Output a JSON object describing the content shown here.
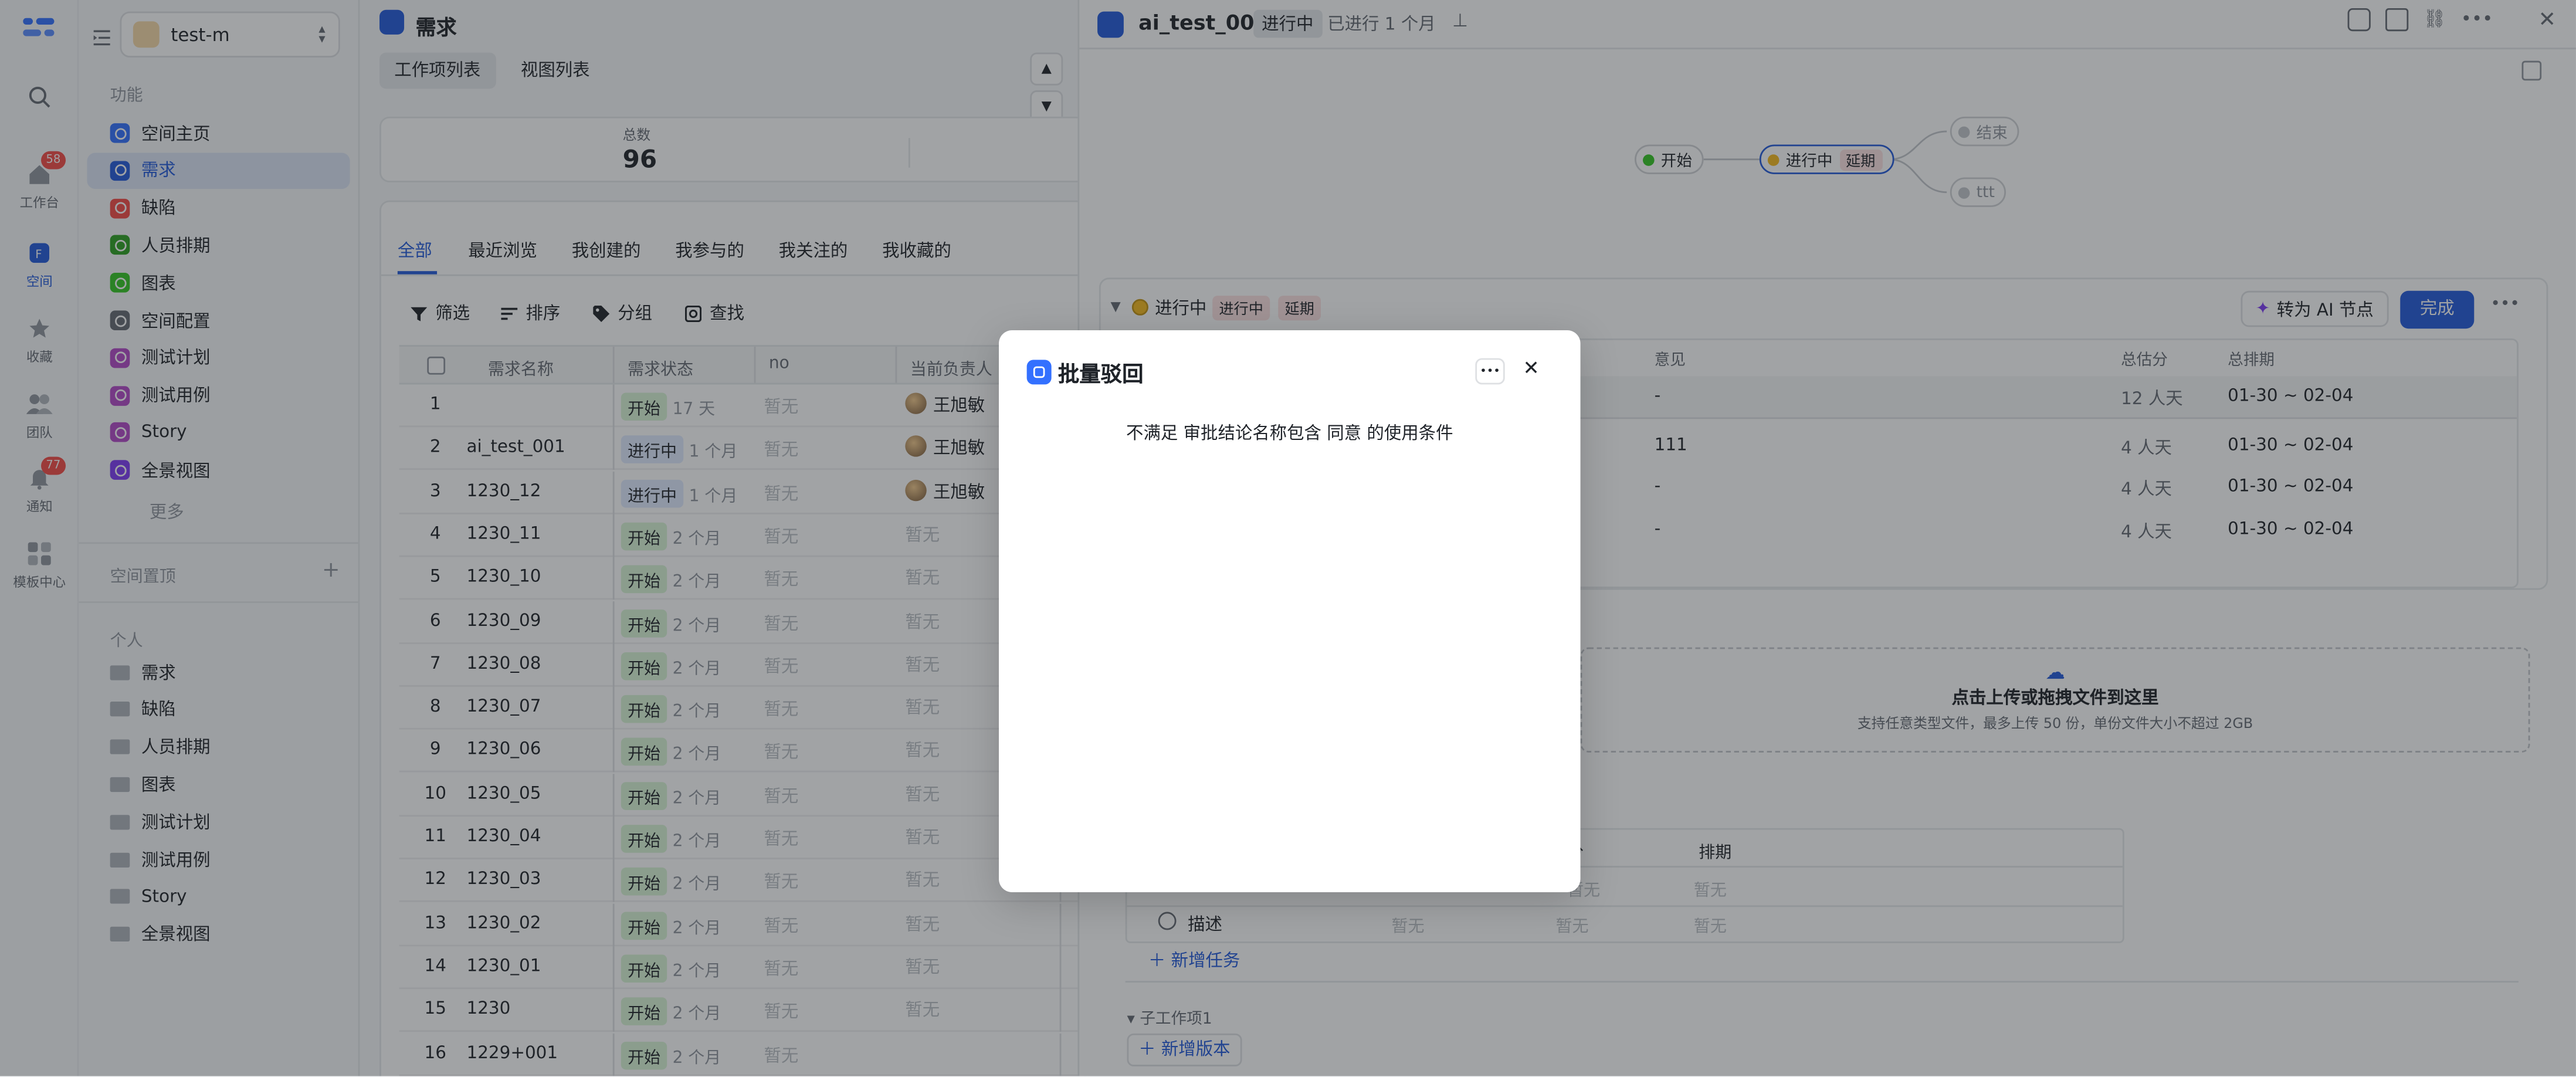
{
  "rail": {
    "items": [
      {
        "label": "",
        "icon": "search-icon"
      },
      {
        "label": "工作台",
        "icon": "home-icon",
        "badge": "58"
      },
      {
        "label": "空间",
        "icon": "space-icon"
      },
      {
        "label": "收藏",
        "icon": "star-icon"
      },
      {
        "label": "团队",
        "icon": "team-icon"
      },
      {
        "label": "通知",
        "icon": "bell-icon",
        "badge": "77"
      },
      {
        "label": "模板中心",
        "icon": "template-icon"
      }
    ]
  },
  "sidebar": {
    "space_name": "test-m",
    "section_func": "功能",
    "func_items": [
      {
        "label": "空间主页",
        "color": "#3370ff"
      },
      {
        "label": "需求",
        "color": "#245bdb"
      },
      {
        "label": "缺陷",
        "color": "#f54a45"
      },
      {
        "label": "人员排期",
        "color": "#2ea121"
      },
      {
        "label": "图表",
        "color": "#34c724"
      },
      {
        "label": "空间配置",
        "color": "#646a73"
      },
      {
        "label": "测试计划",
        "color": "#b449c8"
      },
      {
        "label": "测试用例",
        "color": "#b449c8"
      },
      {
        "label": "Story",
        "color": "#b449c8"
      },
      {
        "label": "全景视图",
        "color": "#7f3bf5"
      }
    ],
    "more": "更多",
    "section_pinned": "空间置顶",
    "section_personal": "个人",
    "personal_items": [
      "需求",
      "缺陷",
      "人员排期",
      "图表",
      "测试计划",
      "测试用例",
      "Story",
      "全景视图"
    ]
  },
  "main": {
    "title": "需求",
    "tabs": [
      "工作项列表",
      "视图列表"
    ],
    "total_label": "总数",
    "total_value": "96",
    "filter_tabs": [
      "全部",
      "最近浏览",
      "我创建的",
      "我参与的",
      "我关注的",
      "我收藏的"
    ],
    "toolbar": [
      "筛选",
      "排序",
      "分组",
      "查找"
    ],
    "columns": [
      "需求名称",
      "需求状态",
      "no",
      "当前负责人"
    ],
    "rows": [
      {
        "no": "1",
        "name": "",
        "status": "开始",
        "dur": "17 天",
        "val": "暂无",
        "owner": "王旭敏"
      },
      {
        "no": "2",
        "name": "ai_test_001",
        "status": "进行中",
        "dur": "1 个月",
        "val": "暂无",
        "owner": "王旭敏"
      },
      {
        "no": "3",
        "name": "1230_12",
        "status": "进行中",
        "dur": "1 个月",
        "val": "暂无",
        "owner": "王旭敏"
      },
      {
        "no": "4",
        "name": "1230_11",
        "status": "开始",
        "dur": "2 个月",
        "val": "暂无",
        "owner": "暂无"
      },
      {
        "no": "5",
        "name": "1230_10",
        "status": "开始",
        "dur": "2 个月",
        "val": "暂无",
        "owner": "暂无"
      },
      {
        "no": "6",
        "name": "1230_09",
        "status": "开始",
        "dur": "2 个月",
        "val": "暂无",
        "owner": "暂无"
      },
      {
        "no": "7",
        "name": "1230_08",
        "status": "开始",
        "dur": "2 个月",
        "val": "暂无",
        "owner": "暂无"
      },
      {
        "no": "8",
        "name": "1230_07",
        "status": "开始",
        "dur": "2 个月",
        "val": "暂无",
        "owner": "暂无"
      },
      {
        "no": "9",
        "name": "1230_06",
        "status": "开始",
        "dur": "2 个月",
        "val": "暂无",
        "owner": "暂无"
      },
      {
        "no": "10",
        "name": "1230_05",
        "status": "开始",
        "dur": "2 个月",
        "val": "暂无",
        "owner": "暂无"
      },
      {
        "no": "11",
        "name": "1230_04",
        "status": "开始",
        "dur": "2 个月",
        "val": "暂无",
        "owner": "暂无"
      },
      {
        "no": "12",
        "name": "1230_03",
        "status": "开始",
        "dur": "2 个月",
        "val": "暂无",
        "owner": "暂无"
      },
      {
        "no": "13",
        "name": "1230_02",
        "status": "开始",
        "dur": "2 个月",
        "val": "暂无",
        "owner": "暂无"
      },
      {
        "no": "14",
        "name": "1230_01",
        "status": "开始",
        "dur": "2 个月",
        "val": "暂无",
        "owner": "暂无"
      },
      {
        "no": "15",
        "name": "1230",
        "status": "开始",
        "dur": "2 个月",
        "val": "暂无",
        "owner": "暂无"
      },
      {
        "no": "16",
        "name": "1229+001",
        "status": "开始",
        "dur": "2 个月",
        "val": "暂无",
        "owner": ""
      }
    ]
  },
  "detail": {
    "title": "ai_test_001",
    "status": "进行中",
    "elapsed": "已进行 1 个月",
    "flow": {
      "start": "开始",
      "current": "进行中",
      "current_tag": "延期",
      "end": "结束",
      "other": "ttt"
    },
    "node_header": {
      "status": "进行中",
      "tag1": "进行中",
      "tag2": "延期",
      "ai_button": "转为 AI 节点",
      "done_button": "完成"
    },
    "table_cols": {
      "opinion": "意见",
      "score": "总估分",
      "schedule": "总排期"
    },
    "table_rows": [
      {
        "opinion": "-",
        "score": "12 人天",
        "schedule": "01-30 ~ 02-04"
      },
      {
        "opinion": "111",
        "score": "4 人天",
        "schedule": "01-30 ~ 02-04"
      },
      {
        "opinion": "-",
        "score": "4 人天",
        "schedule": "01-30 ~ 02-04"
      },
      {
        "opinion": "-",
        "score": "4 人天",
        "schedule": "01-30 ~ 02-04"
      }
    ],
    "upload_title": "点击上传或拖拽文件到这里",
    "upload_desc": "支持任意类型文件，最多上传 50 份，单份文件大小不超过 2GB",
    "task_cols": {
      "score": "分",
      "schedule": "排期"
    },
    "task_row": {
      "name": "描述",
      "v1": "暂无",
      "v2": "暂无",
      "v3": "暂无"
    },
    "task_row_top": {
      "v1": "暂无",
      "v2": "暂无"
    },
    "add_task": "新增任务",
    "sub_section": "子工作项1",
    "add_version": "新增版本"
  },
  "modal": {
    "title": "批量驳回",
    "message": "不满足 审批结论名称包含 同意 的使用条件"
  }
}
